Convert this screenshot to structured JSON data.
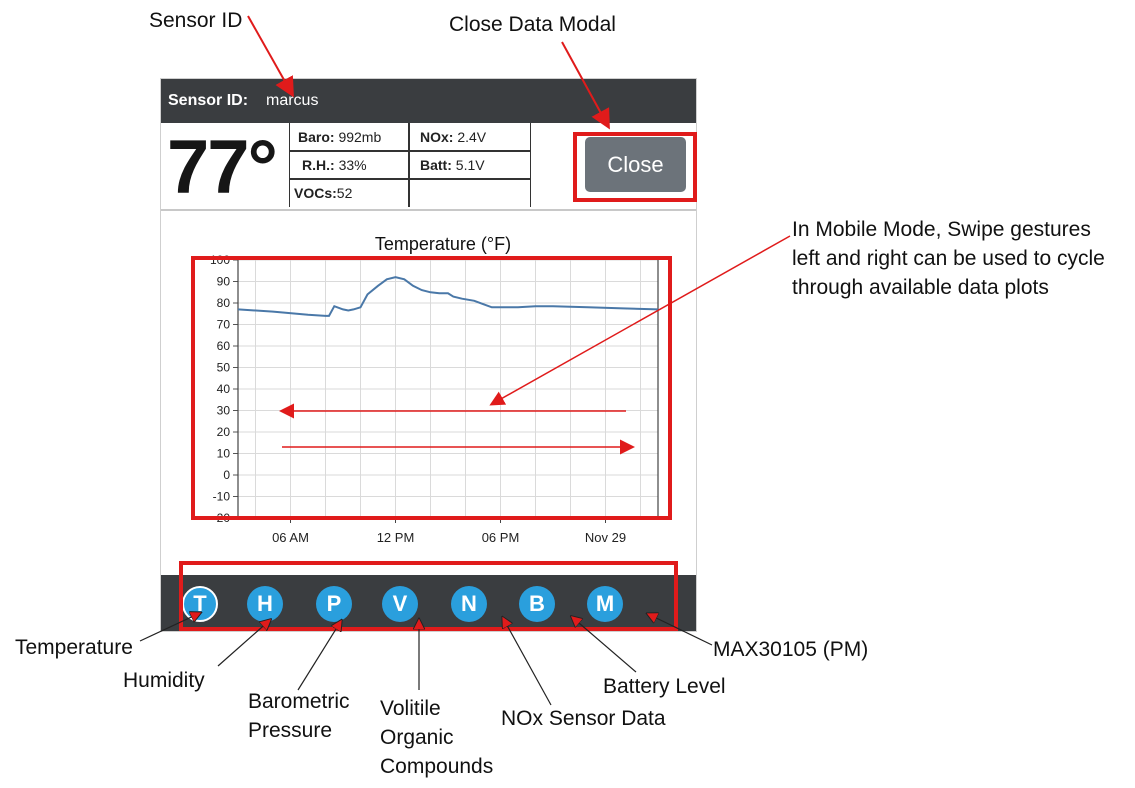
{
  "annotations": {
    "sensor_id": "Sensor ID",
    "close_modal": "Close Data Modal",
    "swipe": [
      "In Mobile Mode, Swipe gestures",
      "left and right can be used to cycle",
      "through available data plots"
    ],
    "temperature": "Temperature",
    "humidity": "Humidity",
    "baro": [
      "Barometric",
      "Pressure"
    ],
    "voc": [
      "Volitile",
      "Organic",
      "Compounds"
    ],
    "nox": "NOx Sensor Data",
    "battery": "Battery Level",
    "max": "MAX30105 (PM)"
  },
  "header": {
    "label": "Sensor ID:",
    "value": "marcus"
  },
  "stats": {
    "temperature": "77°",
    "baro_label": "Baro:",
    "baro_value": "992mb",
    "nox_label": "NOx:",
    "nox_value": "2.4V",
    "rh_label": "R.H.:",
    "rh_value": "33%",
    "batt_label": "Batt:",
    "batt_value": "5.1V",
    "voc_label": "VOCs:",
    "voc_value": "52"
  },
  "close_label": "Close",
  "nav": [
    {
      "letter": "T",
      "active": true
    },
    {
      "letter": "H",
      "active": false
    },
    {
      "letter": "P",
      "active": false
    },
    {
      "letter": "V",
      "active": false
    },
    {
      "letter": "N",
      "active": false
    },
    {
      "letter": "B",
      "active": false
    },
    {
      "letter": "M",
      "active": false
    }
  ],
  "colors": {
    "header_bg": "#3a3d40",
    "accent": "#2a9fdd",
    "annotation_red": "#e01b1b",
    "line": "#4a78a8",
    "close_btn": "#6c737a"
  },
  "chart_data": {
    "type": "line",
    "title": "Temperature (°F)",
    "ylim": [
      -20,
      100
    ],
    "yticks": [
      -20,
      -10,
      0,
      10,
      20,
      30,
      40,
      50,
      60,
      70,
      80,
      90,
      100
    ],
    "xlim": [
      0,
      24
    ],
    "xticks": [
      {
        "x": 3,
        "label": "06 AM"
      },
      {
        "x": 9,
        "label": "12 PM"
      },
      {
        "x": 15,
        "label": "06 PM"
      },
      {
        "x": 21,
        "label": "Nov 29"
      }
    ],
    "grid": true,
    "series": [
      {
        "x": [
          0,
          2,
          4,
          5,
          5.2,
          5.5,
          6,
          6.3,
          6.6,
          7,
          7.4,
          8,
          8.5,
          9,
          9.5,
          10,
          10.5,
          11,
          11.5,
          12,
          12.3,
          12.8,
          13.5,
          14,
          14.5,
          15,
          16,
          17,
          18,
          20,
          22,
          24
        ],
        "y": [
          77,
          76,
          74.5,
          74,
          74,
          78.5,
          77,
          76.5,
          77,
          78,
          84,
          88,
          91,
          92,
          91,
          88,
          86,
          85,
          84.5,
          84.5,
          83,
          82,
          81,
          79.5,
          78,
          78,
          78,
          78.5,
          78.5,
          78,
          77.5,
          77
        ]
      }
    ]
  }
}
